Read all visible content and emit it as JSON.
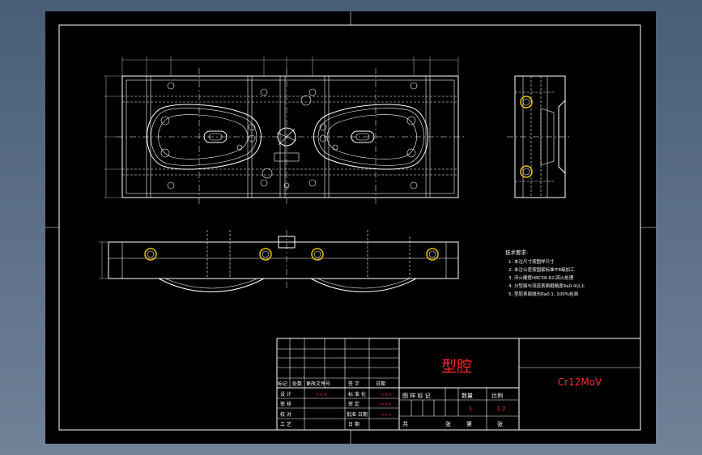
{
  "title_block": {
    "part_name": "型腔",
    "material": "Cr12MoV",
    "labels": {
      "mark": "标记",
      "count": "处数",
      "change_doc": "更改文件号",
      "sign": "签 字",
      "date": "日期",
      "design": "设 计",
      "standardize": "标 准 化",
      "review": "审 核",
      "process": "工 艺",
      "check": "校 对",
      "approve": "审 定",
      "date2": "日 期",
      "approve_date": "批准 日期",
      "stage_mark": "图 样 标 记",
      "qty": "数量",
      "scale": "比例",
      "total": "共",
      "sheet": "张",
      "sheet_no": "第",
      "sheet2": "张"
    },
    "red_marks": [
      "<<<",
      "<<<",
      "<<<",
      "<<<"
    ],
    "qty_value": "1",
    "scale_value": "1:2"
  },
  "notes": {
    "heading": "技术要求:",
    "items": [
      "1. 未注尺寸按图样尺寸",
      "2. 未注公差按国家标准IT8级加工",
      "3. 淬火硬度HRC58-62,回火处理",
      "4. 分型面与流道表面粗糙度Ra0.4以上",
      "5. 型腔表面抛光Ra0.1, 100%检测"
    ]
  },
  "colors": {
    "line": "#ffffff",
    "accent_red": "#ff2a2a",
    "background": "#000000",
    "hole_yellow": "#e8c300"
  }
}
